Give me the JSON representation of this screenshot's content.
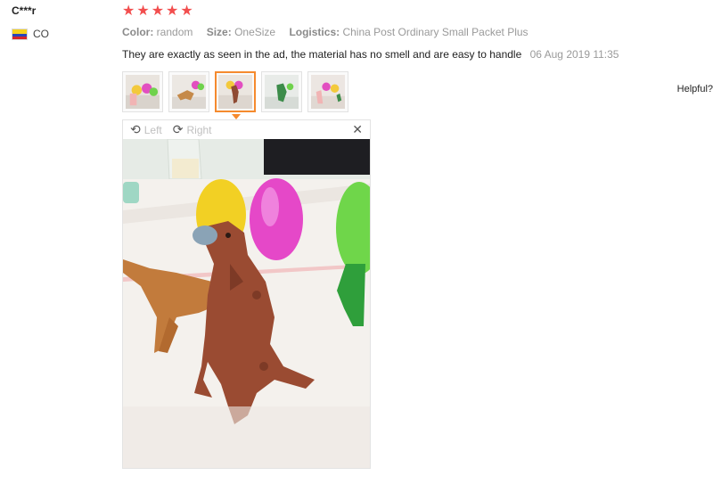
{
  "user": {
    "name": "C***r",
    "country": "CO"
  },
  "rating": {
    "stars": 5
  },
  "attributes": [
    {
      "label": "Color:",
      "value": "random"
    },
    {
      "label": "Size:",
      "value": "OneSize"
    },
    {
      "label": "Logistics:",
      "value": "China Post Ordinary Small Packet Plus"
    }
  ],
  "review": {
    "text": "They are exactly as seen in the ad, the material has no smell and are easy to handle",
    "date": "06 Aug 2019 11:35"
  },
  "thumbnails": {
    "count": 5,
    "selected_index": 2
  },
  "helpful_label": "Helpful?",
  "viewer": {
    "rotate_left_label": "Left",
    "rotate_right_label": "Right",
    "icons": [
      "rotate-left-icon",
      "rotate-right-icon",
      "close-icon"
    ]
  },
  "colors": {
    "star": "#f24e4e",
    "selected_border": "#f58a2e"
  }
}
